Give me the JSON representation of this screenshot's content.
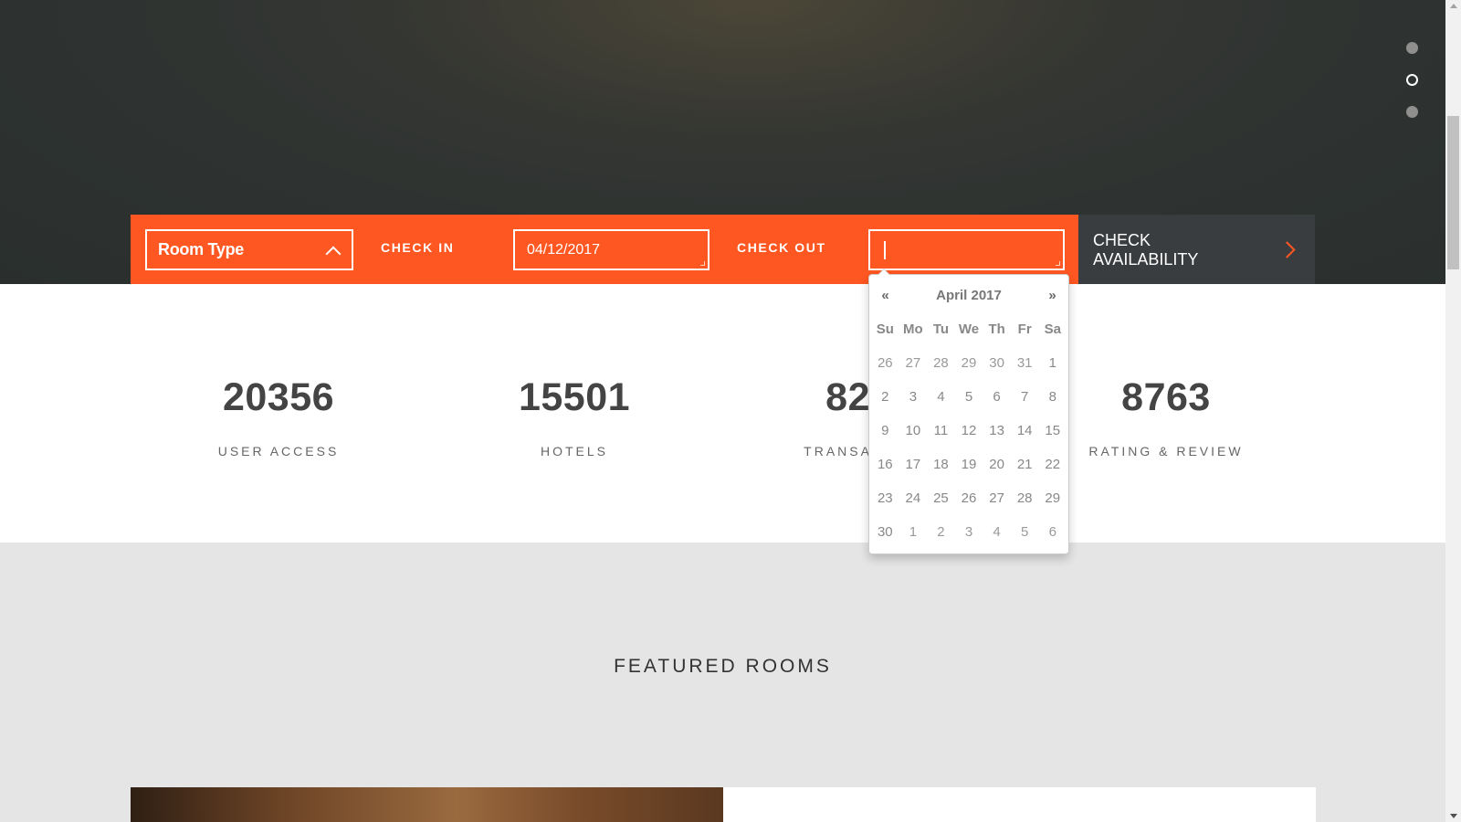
{
  "booking": {
    "room_type": "Room Type",
    "check_in_label": "CHECK IN",
    "check_in_value": "04/12/2017",
    "check_out_label": "CHECK OUT",
    "check_out_value": "",
    "check_button": "CHECK AVAILABILITY"
  },
  "slider": {
    "active_index": 1,
    "count": 3
  },
  "stats": [
    {
      "value": "20356",
      "label": "USER ACCESS"
    },
    {
      "value": "15501",
      "label": "HOTELS"
    },
    {
      "value": "8245",
      "label": "TRANSACTIONS"
    },
    {
      "value": "8763",
      "label": "RATING & REVIEW"
    }
  ],
  "featured": {
    "title": "FEATURED ROOMS"
  },
  "datepicker": {
    "prev": "«",
    "next": "»",
    "month": "April 2017",
    "weekdays": [
      "Su",
      "Mo",
      "Tu",
      "We",
      "Th",
      "Fr",
      "Sa"
    ],
    "weeks": [
      [
        "26",
        "27",
        "28",
        "29",
        "30",
        "31",
        "1"
      ],
      [
        "2",
        "3",
        "4",
        "5",
        "6",
        "7",
        "8"
      ],
      [
        "9",
        "10",
        "11",
        "12",
        "13",
        "14",
        "15"
      ],
      [
        "16",
        "17",
        "18",
        "19",
        "20",
        "21",
        "22"
      ],
      [
        "23",
        "24",
        "25",
        "26",
        "27",
        "28",
        "29"
      ],
      [
        "30",
        "1",
        "2",
        "3",
        "4",
        "5",
        "6"
      ]
    ]
  },
  "colors": {
    "accent": "#ff5722",
    "dark_button": "#3a3d40"
  }
}
